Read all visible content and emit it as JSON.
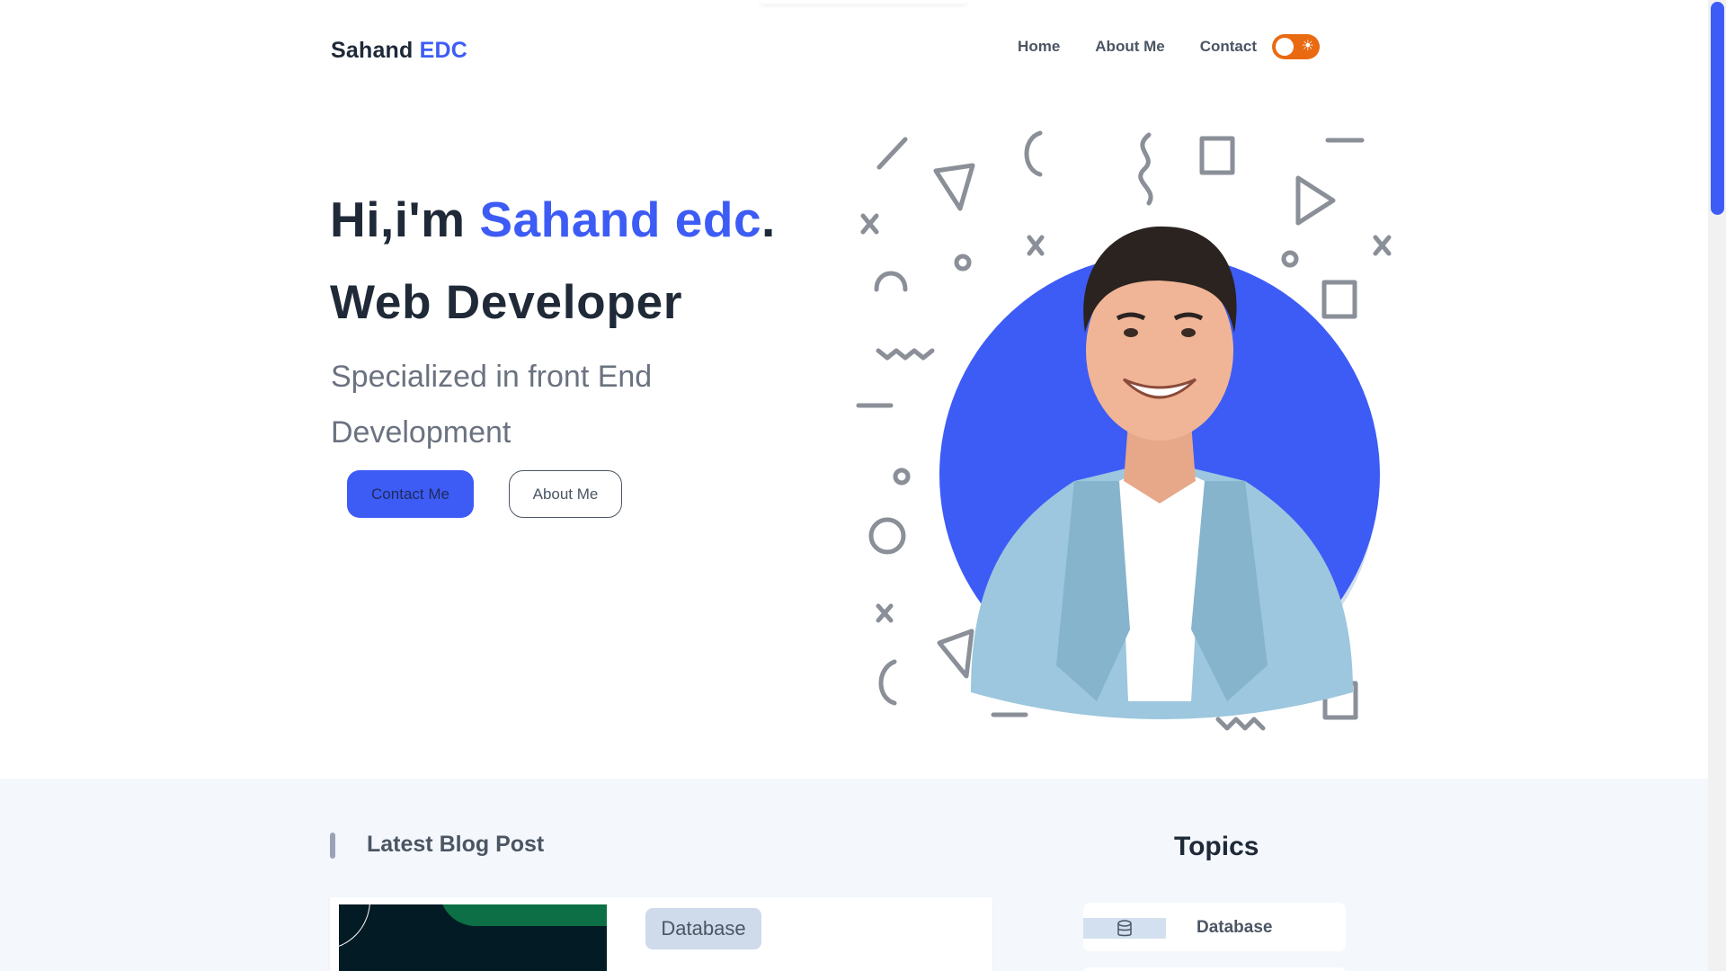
{
  "header": {
    "brand_name": "Sahand",
    "brand_accent": "EDC",
    "nav": [
      "Home",
      "About Me",
      "Contact"
    ],
    "theme_toggle_icon": "sun-icon"
  },
  "hero": {
    "greeting": "Hi,i'm ",
    "name": "Sahand edc",
    "period": ".",
    "role": "Web Developer",
    "subtitle": "Specialized in front End Development",
    "contact_button": "Contact Me",
    "about_button": "About Me"
  },
  "blog": {
    "section_title": "Latest Blog Post",
    "posts": [
      {
        "tag": "Database"
      }
    ]
  },
  "topics": {
    "title": "Topics",
    "items": [
      {
        "label": "Database",
        "icon": "database-icon"
      }
    ]
  },
  "colors": {
    "accent": "#3d5cf5",
    "toggle": "#ea6a12",
    "text_dark": "#1f2937",
    "section_bg": "#f4f8fc"
  }
}
